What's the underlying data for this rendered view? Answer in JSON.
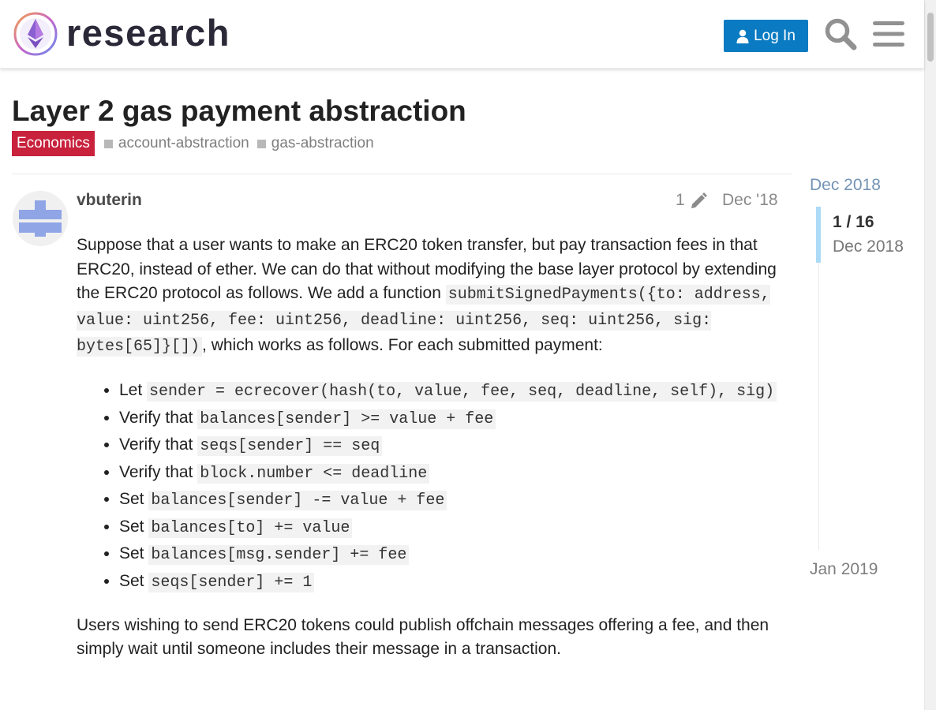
{
  "header": {
    "brand": "research",
    "login_label": "Log In",
    "icons": [
      "logo-icon",
      "user-icon",
      "search-icon",
      "hamburger-menu-icon"
    ],
    "accent_color": "#0a7bc2"
  },
  "topic": {
    "title": "Layer 2 gas payment abstraction",
    "category": "Economics",
    "category_color": "#c8223c",
    "tags": [
      "account-abstraction",
      "gas-abstraction"
    ]
  },
  "post": {
    "username": "vbuterin",
    "edit_count": "1",
    "date": "Dec '18",
    "p1_text1": "Suppose that a user wants to make an ERC20 token transfer, but pay transaction fees in that ERC20, instead of ether. We can do that without modifying the base layer protocol by extending the ERC20 protocol as follows. We add a function ",
    "p1_code": "submitSignedPayments({to: address, value: uint256, fee: uint256, deadline: uint256, seq: uint256, sig: bytes[65]}[])",
    "p1_text2": ", which works as follows. For each submitted payment:",
    "steps": [
      {
        "verb": "Let ",
        "code": "sender = ecrecover(hash(to, value, fee, seq, deadline, self), sig)"
      },
      {
        "verb": "Verify that ",
        "code": "balances[sender] >= value + fee"
      },
      {
        "verb": "Verify that ",
        "code": "seqs[sender] == seq"
      },
      {
        "verb": "Verify that ",
        "code": "block.number <= deadline"
      },
      {
        "verb": "Set ",
        "code": "balances[sender] -= value + fee"
      },
      {
        "verb": "Set ",
        "code": "balances[to] += value"
      },
      {
        "verb": "Set ",
        "code": "balances[msg.sender] += fee"
      },
      {
        "verb": "Set ",
        "code": "seqs[sender] += 1"
      }
    ],
    "p2": "Users wishing to send ERC20 tokens could publish offchain messages offering a fee, and then simply wait until someone includes their message in a transaction."
  },
  "timeline": {
    "start": "Dec 2018",
    "position": "1 / 16",
    "current_date": "Dec 2018",
    "end": "Jan 2019",
    "progress_fraction": 0.0625
  }
}
